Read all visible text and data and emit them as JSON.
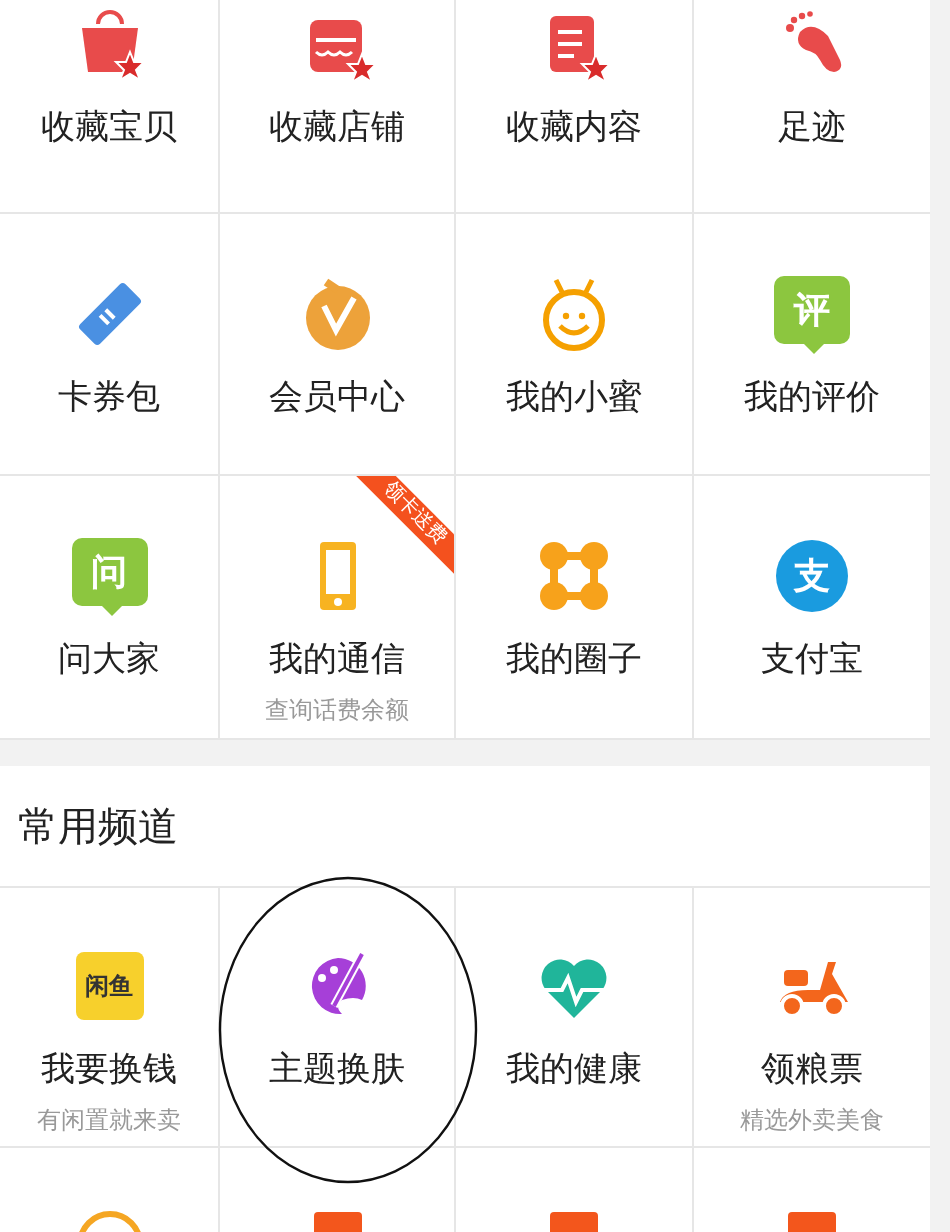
{
  "favorites": [
    {
      "label": "收藏宝贝"
    },
    {
      "label": "收藏店铺"
    },
    {
      "label": "收藏内容"
    },
    {
      "label": "足迹"
    },
    {
      "label": "卡券包"
    },
    {
      "label": "会员中心"
    },
    {
      "label": "我的小蜜"
    },
    {
      "label": "我的评价",
      "badge_text": "评"
    },
    {
      "label": "问大家",
      "badge_text": "问"
    },
    {
      "label": "我的通信",
      "subtitle": "查询话费余额",
      "ribbon": "领卡送费"
    },
    {
      "label": "我的圈子"
    },
    {
      "label": "支付宝",
      "badge_text": "支"
    }
  ],
  "channels": {
    "title": "常用频道",
    "items": [
      {
        "label": "我要换钱",
        "subtitle": "有闲置就来卖",
        "badge_text": "闲鱼"
      },
      {
        "label": "主题换肤"
      },
      {
        "label": "我的健康"
      },
      {
        "label": "领粮票",
        "subtitle": "精选外卖美食"
      }
    ]
  }
}
